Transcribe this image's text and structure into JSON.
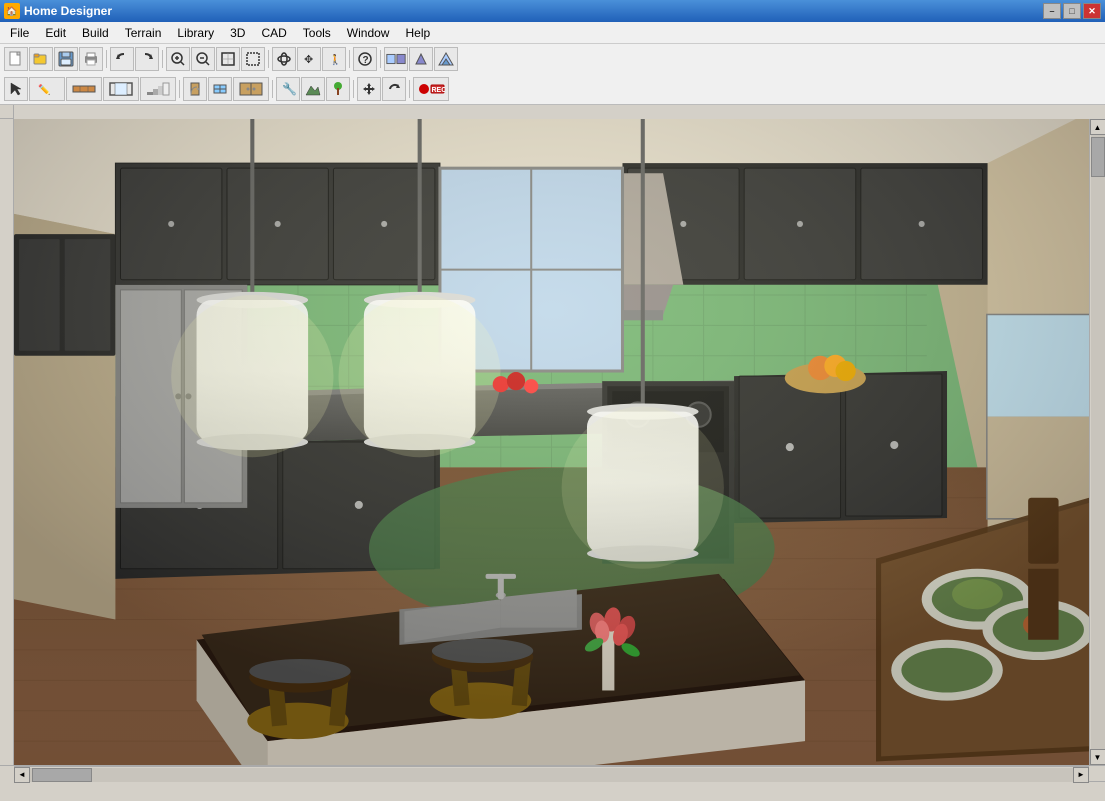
{
  "window": {
    "title": "Home Designer",
    "icon": "🏠"
  },
  "title_controls": {
    "minimize": "–",
    "maximize": "□",
    "close": "✕"
  },
  "menu": {
    "items": [
      {
        "id": "file",
        "label": "File"
      },
      {
        "id": "edit",
        "label": "Edit"
      },
      {
        "id": "build",
        "label": "Build"
      },
      {
        "id": "terrain",
        "label": "Terrain"
      },
      {
        "id": "library",
        "label": "Library"
      },
      {
        "id": "3d",
        "label": "3D"
      },
      {
        "id": "cad",
        "label": "CAD"
      },
      {
        "id": "tools",
        "label": "Tools"
      },
      {
        "id": "window",
        "label": "Window"
      },
      {
        "id": "help",
        "label": "Help"
      }
    ]
  },
  "toolbar1": {
    "buttons": [
      {
        "id": "new",
        "icon": "📄",
        "tip": "New"
      },
      {
        "id": "open",
        "icon": "📂",
        "tip": "Open"
      },
      {
        "id": "save",
        "icon": "💾",
        "tip": "Save"
      },
      {
        "id": "print",
        "icon": "🖨",
        "tip": "Print"
      },
      {
        "id": "undo",
        "icon": "↩",
        "tip": "Undo"
      },
      {
        "id": "redo",
        "icon": "↪",
        "tip": "Redo"
      },
      {
        "id": "zoom-in",
        "icon": "🔍",
        "tip": "Zoom In"
      },
      {
        "id": "zoom-out",
        "icon": "🔎",
        "tip": "Zoom Out"
      },
      {
        "id": "zoom-fit",
        "icon": "⊞",
        "tip": "Fit"
      },
      {
        "id": "zoom-sel",
        "icon": "⊡",
        "tip": "Zoom Selection"
      },
      {
        "id": "orbit",
        "icon": "⟳",
        "tip": "Orbit"
      },
      {
        "id": "pan",
        "icon": "✥",
        "tip": "Pan"
      },
      {
        "id": "walk",
        "icon": "🚶",
        "tip": "Walkthrough"
      },
      {
        "id": "help-btn",
        "icon": "?",
        "tip": "Help"
      },
      {
        "id": "house1",
        "icon": "🏠",
        "tip": "Floor Plan"
      },
      {
        "id": "house2",
        "icon": "🏡",
        "tip": "Perspective"
      },
      {
        "id": "house3",
        "icon": "⛪",
        "tip": "Camera"
      }
    ]
  },
  "toolbar2": {
    "buttons": [
      {
        "id": "select",
        "icon": "↖",
        "tip": "Select"
      },
      {
        "id": "draw",
        "icon": "✏",
        "tip": "Draw"
      },
      {
        "id": "wall",
        "icon": "⊟",
        "tip": "Wall"
      },
      {
        "id": "room",
        "icon": "▦",
        "tip": "Room"
      },
      {
        "id": "stair",
        "icon": "⊞",
        "tip": "Stair"
      },
      {
        "id": "door",
        "icon": "🚪",
        "tip": "Door"
      },
      {
        "id": "window-tool",
        "icon": "⬜",
        "tip": "Window"
      },
      {
        "id": "cabinet",
        "icon": "▥",
        "tip": "Cabinet"
      },
      {
        "id": "fixture",
        "icon": "🔧",
        "tip": "Fixture"
      },
      {
        "id": "terrain-tool",
        "icon": "⛰",
        "tip": "Terrain"
      },
      {
        "id": "plant",
        "icon": "🌿",
        "tip": "Plant"
      },
      {
        "id": "move",
        "icon": "✛",
        "tip": "Move"
      },
      {
        "id": "rotate",
        "icon": "↻",
        "tip": "Rotate"
      },
      {
        "id": "record",
        "icon": "⏺",
        "tip": "Record"
      }
    ]
  },
  "status": {
    "text": ""
  }
}
